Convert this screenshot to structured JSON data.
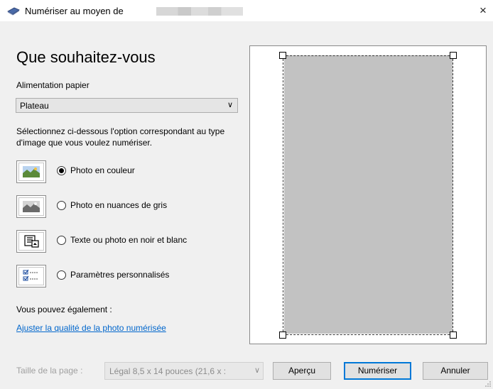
{
  "window": {
    "title": "Numériser au moyen de",
    "close_glyph": "×"
  },
  "heading": "Que souhaitez-vous",
  "paper_source": {
    "label": "Alimentation papier",
    "value": "Plateau"
  },
  "description": "Sélectionnez ci-dessous l'option correspondant au type d'image que vous voulez numériser.",
  "options": [
    {
      "label": "Photo en couleur",
      "icon": "color-photo-icon",
      "selected": true
    },
    {
      "label": "Photo en nuances de gris",
      "icon": "grayscale-photo-icon",
      "selected": false
    },
    {
      "label": "Texte ou photo en noir et blanc",
      "icon": "text-bw-icon",
      "selected": false
    },
    {
      "label": "Paramètres personnalisés",
      "icon": "custom-settings-icon",
      "selected": false
    }
  ],
  "also_text": "Vous pouvez également :",
  "adjust_link": "Ajuster la qualité de la photo numérisée",
  "page_size": {
    "label": "Taille de la page :",
    "value": "Légal 8,5 x 14 pouces (21,6 x :"
  },
  "buttons": {
    "preview": "Aperçu",
    "scan": "Numériser",
    "cancel": "Annuler"
  },
  "colors": {
    "accent": "#0078d7",
    "link": "#0066cc",
    "preview_gray": "#c2c2c2"
  }
}
